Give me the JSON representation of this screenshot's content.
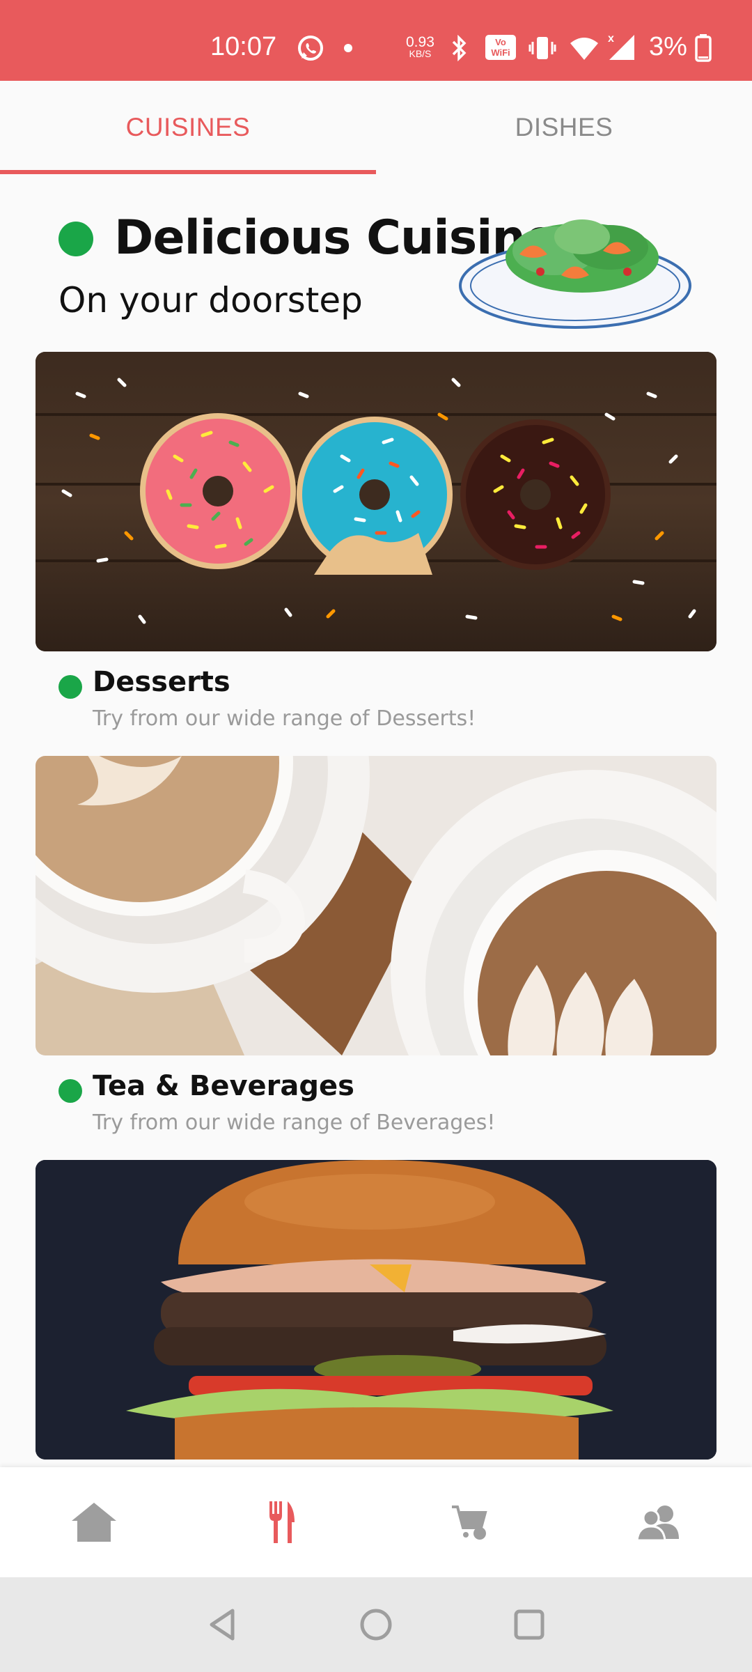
{
  "status_bar": {
    "time": "10:07",
    "net_speed_value": "0.93",
    "net_speed_unit": "KB/S",
    "wifi_badge_top": "Vo",
    "wifi_badge_bottom": "WiFi",
    "battery": "3%"
  },
  "tabs": [
    {
      "label": "CUISINES",
      "active": true
    },
    {
      "label": "DISHES",
      "active": false
    }
  ],
  "hero": {
    "title": "Delicious Cuisines",
    "subtitle": "On your doorstep"
  },
  "cards": [
    {
      "title": "Desserts",
      "description": "Try from our wide range of Desserts!",
      "image": "donuts-photo"
    },
    {
      "title": "Tea & Beverages",
      "description": "Try from our wide range of Beverages!",
      "image": "coffee-photo"
    },
    {
      "title": "",
      "description": "",
      "image": "burger-photo"
    }
  ],
  "bottom_nav": [
    {
      "icon": "home-icon",
      "active": false
    },
    {
      "icon": "fork-knife-icon",
      "active": true
    },
    {
      "icon": "cart-icon",
      "active": false
    },
    {
      "icon": "profile-icon",
      "active": false
    }
  ],
  "colors": {
    "accent": "#e85a5c",
    "dot_green": "#1aa648",
    "inactive_icon": "#9e9e9e"
  }
}
